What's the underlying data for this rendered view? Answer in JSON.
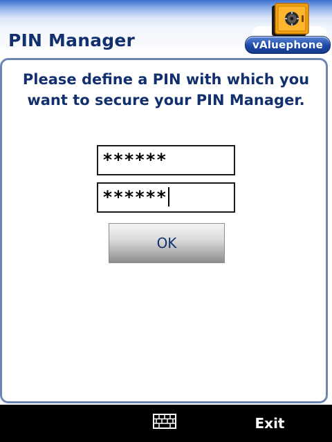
{
  "app": {
    "title": "PIN Manager",
    "brand": "vAluephone"
  },
  "dialog": {
    "prompt": "Please define a PIN with which you want to secure your PIN Manager.",
    "pin_field_1_value": "******",
    "pin_field_2_value": "******",
    "ok_label": "OK"
  },
  "softkeys": {
    "right_label": "Exit",
    "center_icon": "keyboard-icon"
  },
  "colors": {
    "title_text": "#12306e",
    "panel_border": "#6b86b2",
    "brand_blue": "#1d4aa6",
    "safe_orange": "#f5a214",
    "softkey_bar": "#000000"
  }
}
